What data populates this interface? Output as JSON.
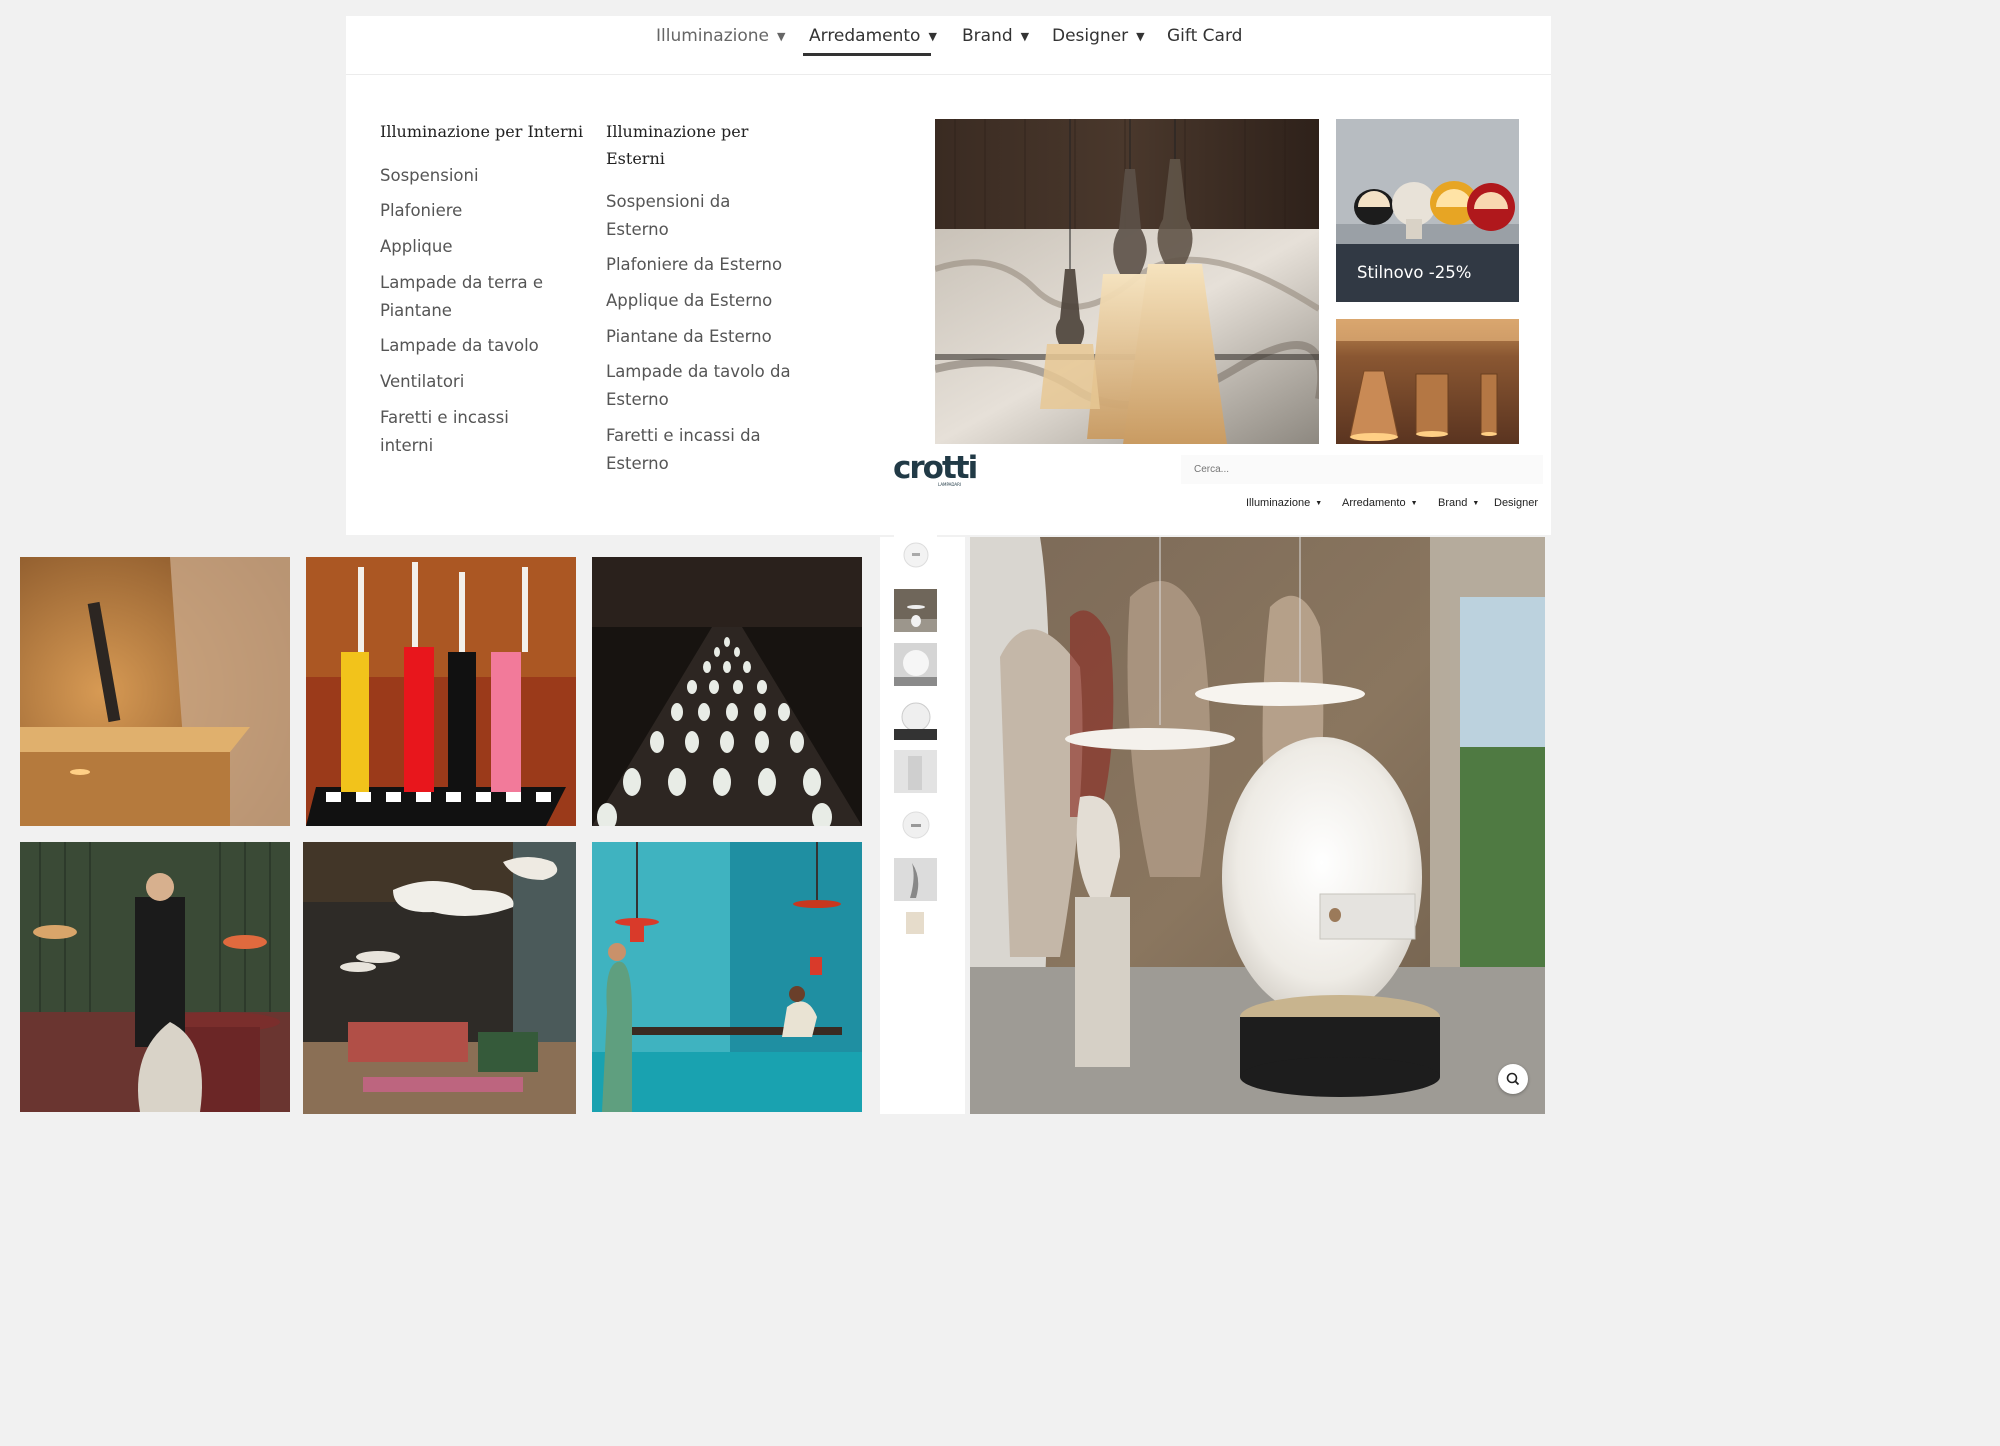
{
  "nav": {
    "items": [
      {
        "label": "Illuminazione"
      },
      {
        "label": "Arredamento"
      },
      {
        "label": "Brand"
      },
      {
        "label": "Designer"
      },
      {
        "label": "Gift Card"
      }
    ],
    "active": "Arredamento"
  },
  "mega": {
    "interni": {
      "title": "Illuminazione per Interni",
      "links": [
        "Sospensioni",
        "Plafoniere",
        "Applique",
        "Lampade da terra e",
        "Piantane",
        "Lampade da tavolo",
        "Ventilatori",
        "Faretti e incassi",
        "interni"
      ]
    },
    "esterni": {
      "title_line1": "Illuminazione per",
      "title_line2": "Esterni",
      "links": [
        "Sospensioni da",
        "Esterno",
        "Plafoniere da Esterno",
        "Applique da Esterno",
        "Piantane da Esterno",
        "Lampade da tavolo da",
        "Esterno",
        "Faretti e incassi da",
        "Esterno"
      ]
    },
    "promo": "Stilnovo -25%"
  },
  "product_header": {
    "logo": "crotti",
    "logo_sub": "LAMPADARI",
    "search_placeholder": "Cerca...",
    "nav": [
      "Illuminazione",
      "Arredamento",
      "Brand",
      "Designer"
    ]
  },
  "icons": {
    "dropdown": "chevron-down-icon",
    "zoom": "magnifier-icon"
  },
  "colors": {
    "logo": "#213a46",
    "promo_overlay": "#28303c"
  }
}
